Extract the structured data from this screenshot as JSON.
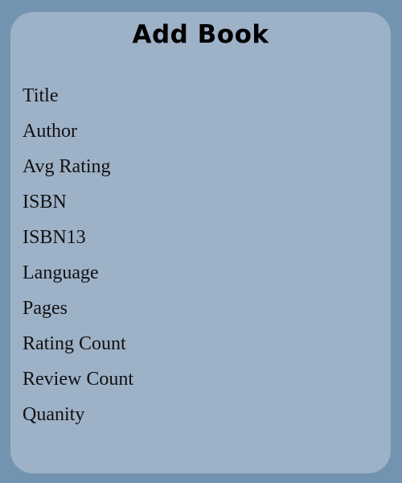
{
  "form": {
    "title": "Add Book",
    "fields": [
      {
        "label": "Title"
      },
      {
        "label": "Author"
      },
      {
        "label": "Avg Rating"
      },
      {
        "label": "ISBN"
      },
      {
        "label": "ISBN13"
      },
      {
        "label": "Language"
      },
      {
        "label": "Pages"
      },
      {
        "label": "Rating Count"
      },
      {
        "label": "Review Count"
      },
      {
        "label": "Quanity"
      }
    ]
  },
  "colors": {
    "page_background": "#7394b0",
    "card_background": "#9db1c7",
    "text": "#111111"
  }
}
